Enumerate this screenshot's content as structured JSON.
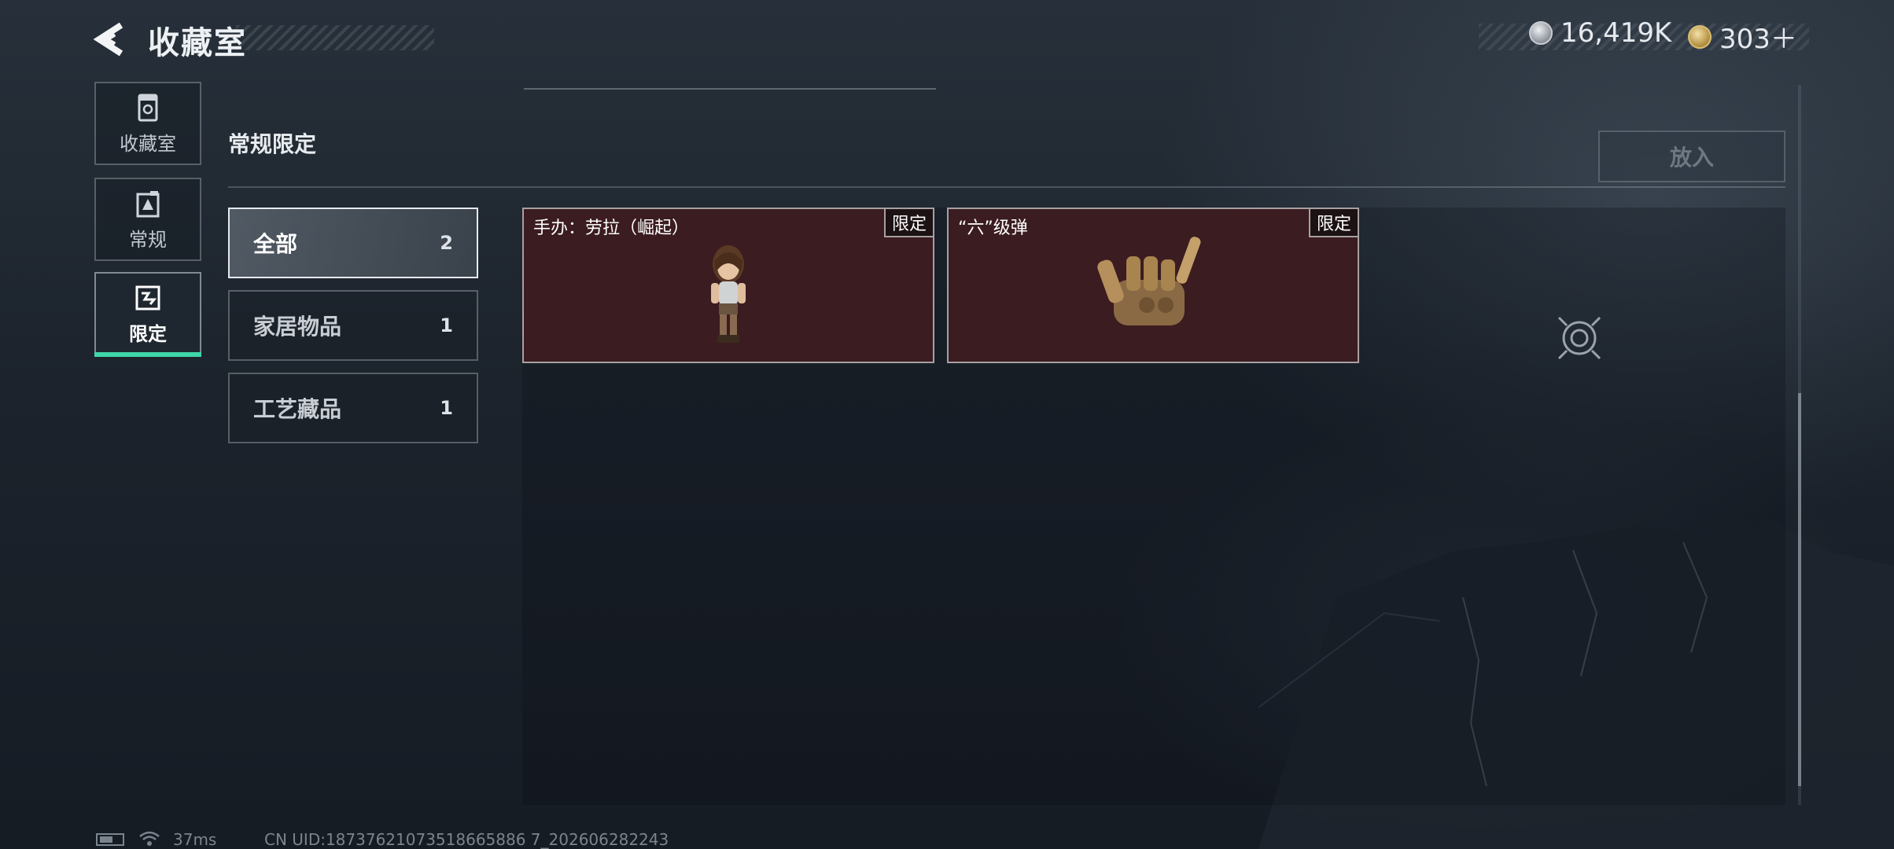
{
  "header": {
    "title": "收藏室",
    "currencies": [
      {
        "icon": "silver-coin-icon",
        "value": "16,419K"
      },
      {
        "icon": "gold-coin-icon",
        "value": "303＋"
      }
    ]
  },
  "sidebar": {
    "items": [
      {
        "label": "收藏室",
        "icon": "collection-icon",
        "active": false
      },
      {
        "label": "常规",
        "icon": "regular-icon",
        "active": false
      },
      {
        "label": "限定",
        "icon": "limited-icon",
        "active": true
      }
    ]
  },
  "section": {
    "title": "常规限定",
    "put_button": "放入"
  },
  "categories": [
    {
      "label": "全部",
      "count": "2",
      "active": true
    },
    {
      "label": "家居物品",
      "count": "1",
      "active": false
    },
    {
      "label": "工艺藏品",
      "count": "1",
      "active": false
    }
  ],
  "items": [
    {
      "name": "手办：劳拉（崛起）",
      "tag": "限定",
      "art": "figurine-icon"
    },
    {
      "name": "“六”级弹",
      "tag": "限定",
      "art": "bullet-hand-icon"
    }
  ],
  "status": {
    "ping": "37ms",
    "uid": "CN UID:18737621073518665886 7_202606282243"
  },
  "colors": {
    "accent": "#3fd6a8",
    "card_bg": "#3b1c20"
  }
}
